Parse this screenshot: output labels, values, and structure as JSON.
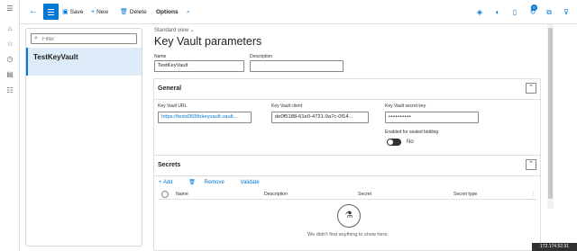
{
  "toolbar": {
    "save": "Save",
    "new": "New",
    "delete": "Delete",
    "options": "Options",
    "notification_count": "0"
  },
  "list": {
    "filter_placeholder": "Filter",
    "items": [
      "TestKeyVault"
    ]
  },
  "main": {
    "view_selector": "Standard view",
    "title": "Key Vault parameters",
    "name_label": "Name",
    "name_value": "TestKeyVault",
    "description_label": "Description",
    "description_value": ""
  },
  "general": {
    "title": "General",
    "url_label": "Key Vault URL",
    "url_value": "https://testd365fokeyvault.vault...",
    "client_label": "Key Vault client",
    "client_value": "de0f5188-61e0-4721-9a7c-0f14...",
    "secret_key_label": "Key Vault secret key",
    "secret_key_value": "••••••••••",
    "sealed_label": "Enabled for sealed bidding",
    "sealed_value": "No"
  },
  "secrets": {
    "title": "Secrets",
    "add": "Add",
    "remove": "Remove",
    "validate": "Validate",
    "columns": [
      "Name",
      "Description",
      "Secret",
      "Secret type"
    ],
    "empty_text": "We didn't find anything to show here."
  },
  "status": {
    "ip": "172.174.52.91"
  },
  "colors": {
    "accent": "#0078d4",
    "selected_bg": "#deecf9"
  }
}
